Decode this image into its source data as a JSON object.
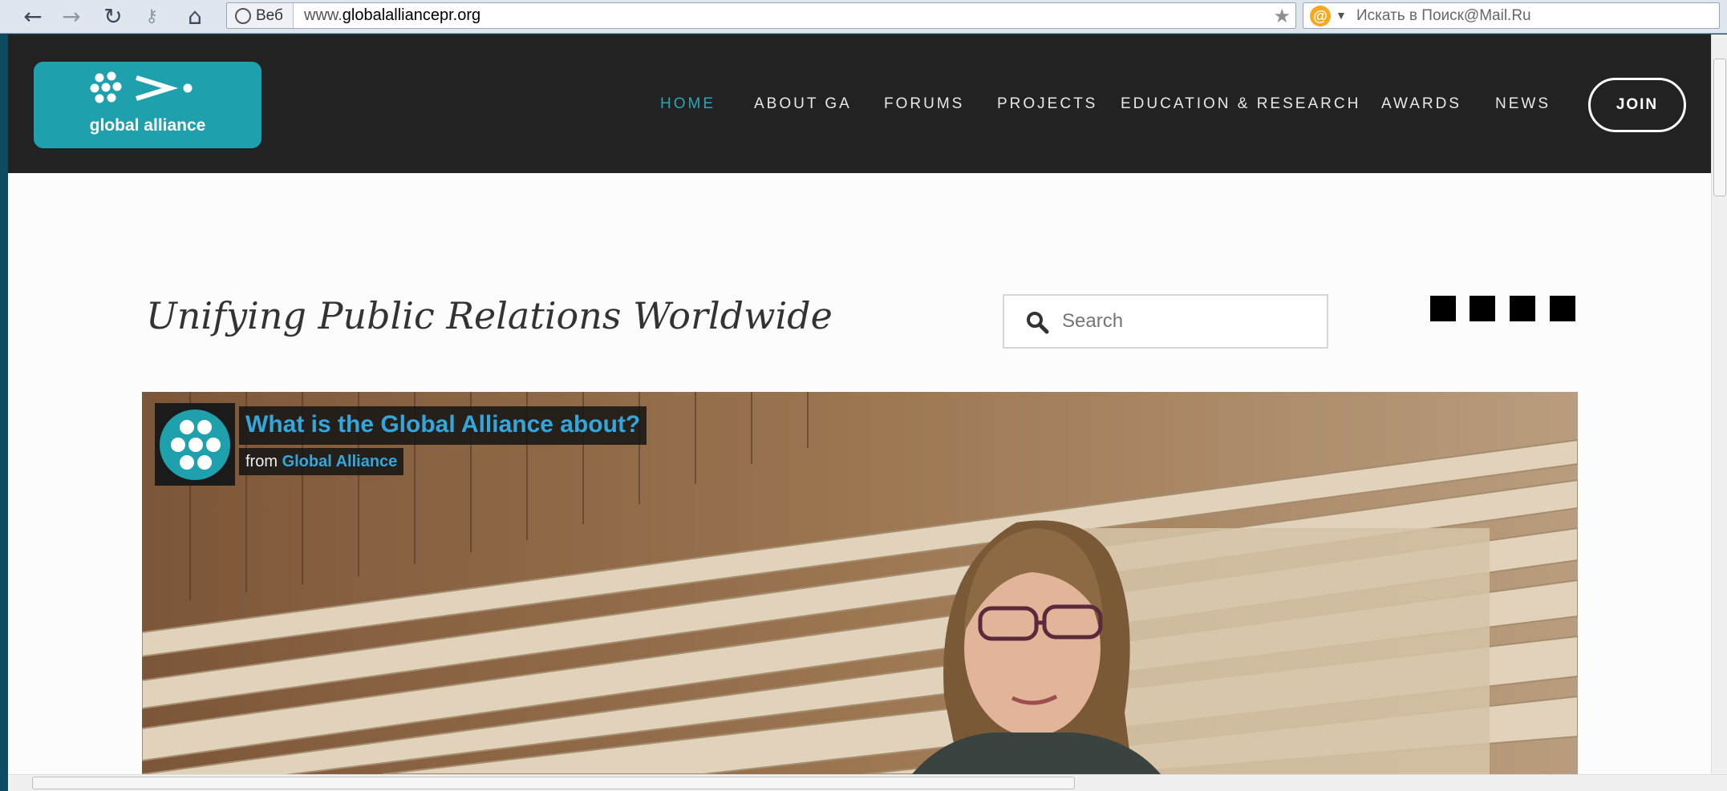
{
  "browser": {
    "web_label": "Веб",
    "url_prefix": "www.",
    "url_domain": "globalalliancepr.org",
    "search_placeholder": "Искать в Поиск@Mail.Ru",
    "icons": [
      "back-icon",
      "forward-icon",
      "reload-icon",
      "key-icon",
      "home-icon",
      "globe-icon",
      "star-icon",
      "mail-search-icon"
    ]
  },
  "site": {
    "logo_text": "global alliance",
    "nav": [
      {
        "label": "HOME",
        "active": true
      },
      {
        "label": "ABOUT GA",
        "active": false
      },
      {
        "label": "FORUMS",
        "active": false
      },
      {
        "label": "PROJECTS",
        "active": false
      },
      {
        "label": "EDUCATION & RESEARCH",
        "active": false
      },
      {
        "label": "AWARDS",
        "active": false
      },
      {
        "label": "NEWS",
        "active": false
      }
    ],
    "join_label": "JOIN",
    "tagline": "Unifying Public Relations Worldwide",
    "search_placeholder": "Search",
    "social": [
      "facebook-icon",
      "twitter-icon",
      "vimeo-icon",
      "linkedin-icon"
    ],
    "colors": {
      "accent": "#2aa6b6",
      "header_bg": "#222222",
      "video_link": "#33a7dc"
    }
  },
  "video": {
    "title": "What is the Global Alliance about?",
    "from_label": "from",
    "channel": "Global Alliance"
  }
}
